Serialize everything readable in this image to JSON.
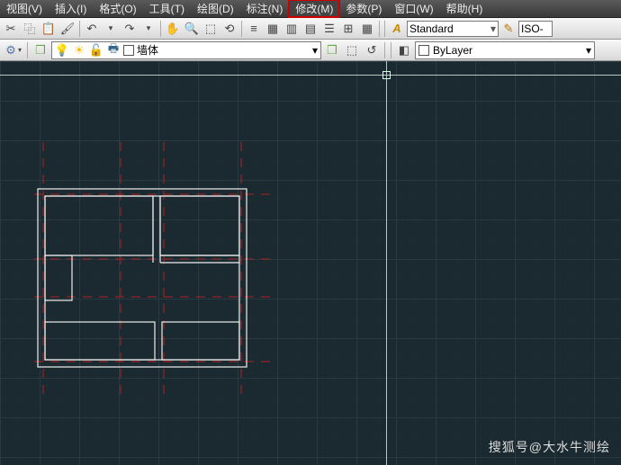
{
  "menu": {
    "items": [
      "视图(V)",
      "插入(I)",
      "格式(O)",
      "工具(T)",
      "绘图(D)",
      "标注(N)",
      "修改(M)",
      "参数(P)",
      "窗口(W)",
      "帮助(H)"
    ],
    "highlighted_index": 6
  },
  "toolbar": {
    "text_style": "Standard",
    "dim_style": "ISO-"
  },
  "layerbar": {
    "current_layer": "墙体",
    "bylayer": "ByLayer"
  },
  "watermark": "搜狐号@大水牛测绘"
}
